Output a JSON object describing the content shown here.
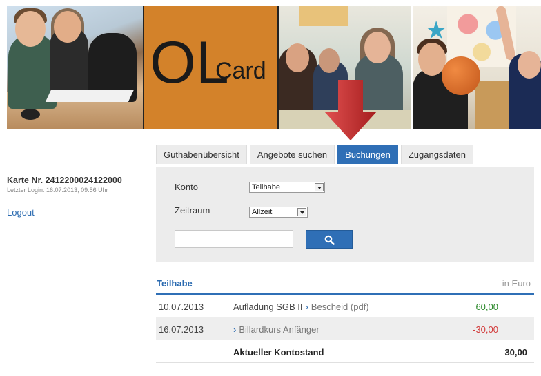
{
  "banner": {
    "logo_big": "OL",
    "logo_small": "Card"
  },
  "sidebar": {
    "card_number": "Karte Nr. 2412200024122000",
    "last_login": "Letzter Login: 16.07.2013, 09:56 Uhr",
    "logout_label": "Logout"
  },
  "tabs": [
    {
      "label": "Guthabenübersicht",
      "active": false
    },
    {
      "label": "Angebote suchen",
      "active": false
    },
    {
      "label": "Buchungen",
      "active": true
    },
    {
      "label": "Zugangsdaten",
      "active": false
    }
  ],
  "filter": {
    "konto_label": "Konto",
    "konto_value": "Teilhabe",
    "zeitraum_label": "Zeitraum",
    "zeitraum_value": "Allzeit",
    "search_value": ""
  },
  "table": {
    "title": "Teilhabe",
    "unit": "in  Euro",
    "rows": [
      {
        "date": "10.07.2013",
        "desc": "Aufladung SGB II",
        "link": "Bescheid (pdf)",
        "amount": "60,00"
      },
      {
        "date": "16.07.2013",
        "desc": "",
        "link": "Billardkurs Anfänger",
        "amount": "-30,00"
      }
    ],
    "total_label": "Aktueller Kontostand",
    "total_value": "30,00"
  },
  "colors": {
    "accent": "#2f6fb6",
    "logo_bg": "#d3822a",
    "positive": "#2e8b2e",
    "negative": "#d23a3a",
    "arrow": "#c62828"
  },
  "icons": {
    "search_button": "search-icon",
    "arrows": "red-arrow-icon"
  }
}
